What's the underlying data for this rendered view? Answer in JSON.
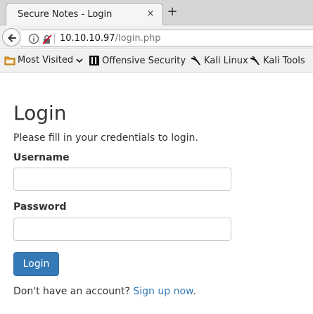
{
  "browser": {
    "tab": {
      "title": "Secure Notes - Login",
      "close_glyph": "×"
    },
    "new_tab_glyph": "+",
    "url": {
      "host": "10.10.10.97",
      "path": "/login.php"
    },
    "icons": [
      "back-arrow-icon",
      "info-icon",
      "insecure-lock-icon"
    ],
    "bookmarks": [
      {
        "label": "Most Visited",
        "icon": "folder-icon",
        "has_dropdown": true
      },
      {
        "label": "Offensive Security",
        "icon": "offsec-icon"
      },
      {
        "label": "Kali Linux",
        "icon": "kali-dragon-icon"
      },
      {
        "label": "Kali Tools",
        "icon": "kali-dragon-icon"
      }
    ]
  },
  "page": {
    "title": "Login",
    "intro": "Please fill in your credentials to login.",
    "username": {
      "label": "Username",
      "value": ""
    },
    "password": {
      "label": "Password",
      "value": ""
    },
    "submit_label": "Login",
    "signup": {
      "prompt": "Don't have an account?",
      "link_text": "Sign up now",
      "suffix": "."
    }
  },
  "colors": {
    "primary": "#337ab7",
    "text": "#333333"
  }
}
